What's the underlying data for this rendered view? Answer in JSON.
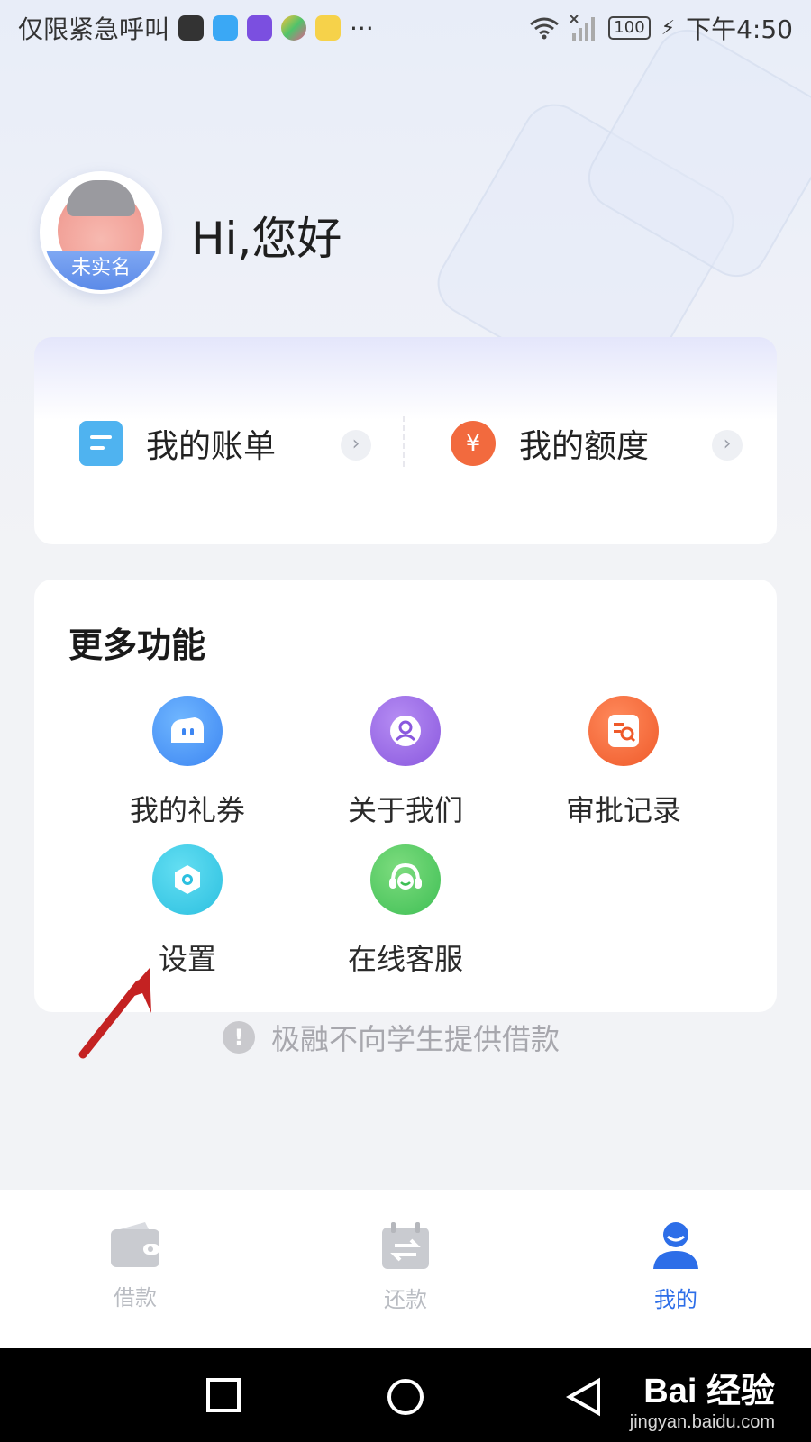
{
  "status_bar": {
    "carrier_text": "仅限紧急呼叫",
    "more": "···",
    "battery": "100",
    "time": "下午4:50"
  },
  "profile": {
    "badge": "未实名",
    "greeting": "Hi,您好"
  },
  "quick_actions": [
    {
      "label": "我的账单",
      "icon": "bill-icon"
    },
    {
      "label": "我的额度",
      "icon": "yuan-icon",
      "glyph": "¥"
    }
  ],
  "more_functions": {
    "title": "更多功能",
    "items": [
      {
        "label": "我的礼券",
        "icon": "coupon-icon"
      },
      {
        "label": "关于我们",
        "icon": "about-us-icon"
      },
      {
        "label": "审批记录",
        "icon": "approval-record-icon"
      },
      {
        "label": "设置",
        "icon": "settings-icon"
      },
      {
        "label": "在线客服",
        "icon": "customer-service-icon"
      }
    ]
  },
  "notice": {
    "text": "极融不向学生提供借款"
  },
  "bottom_nav": [
    {
      "label": "借款",
      "icon": "wallet-icon",
      "active": false
    },
    {
      "label": "还款",
      "icon": "calendar-repay-icon",
      "active": false
    },
    {
      "label": "我的",
      "icon": "profile-icon",
      "active": true
    }
  ],
  "watermark": {
    "brand": "Bai 经验",
    "url": "jingyan.baidu.com"
  },
  "colors": {
    "accent": "#2d6ee8",
    "bill": "#4fb3f0",
    "quota": "#f26a3e"
  }
}
